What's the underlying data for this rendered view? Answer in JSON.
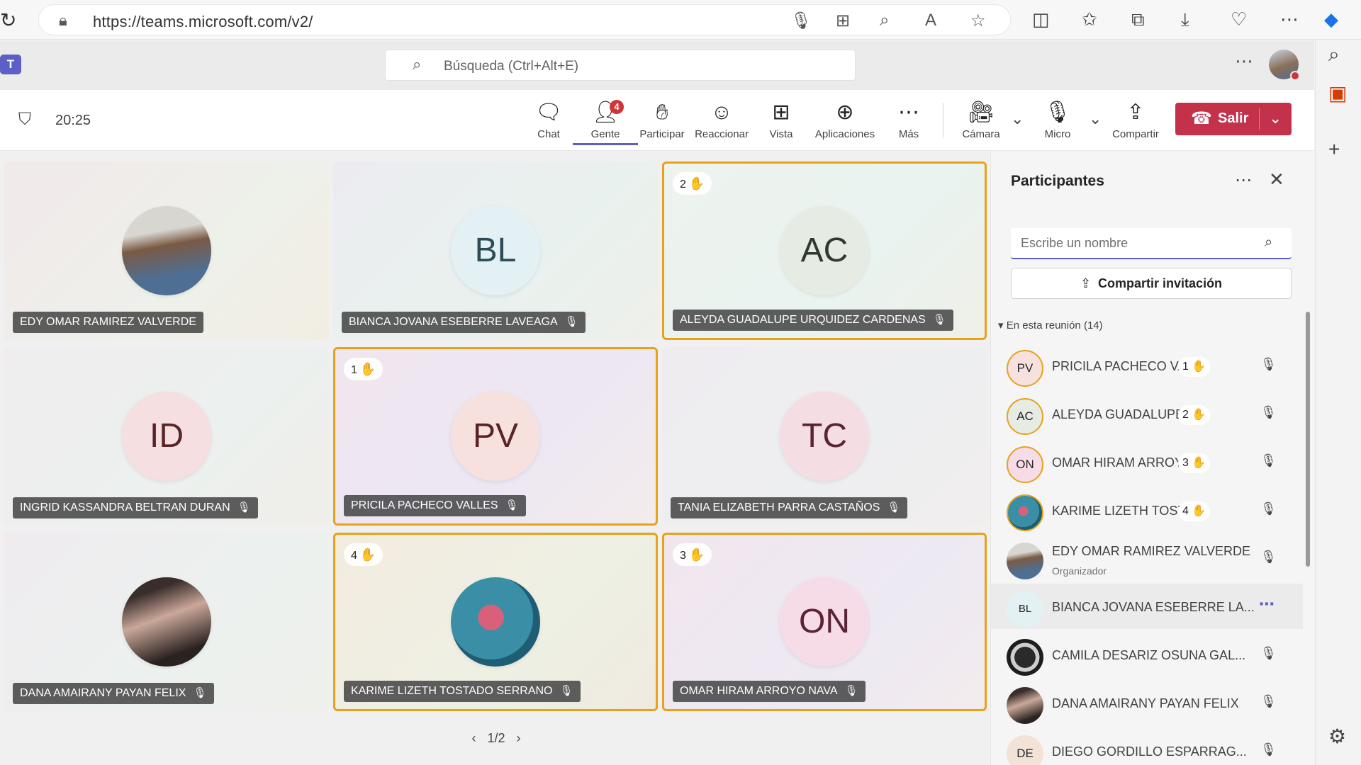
{
  "browser": {
    "url": "https://teams.microsoft.com/v2/"
  },
  "header": {
    "logo_text": "T",
    "search_placeholder": "Búsqueda (Ctrl+Alt+E)"
  },
  "meeting": {
    "timer": "20:25",
    "toolbar": [
      {
        "label": "Chat",
        "icon": "chat-icon"
      },
      {
        "label": "Gente",
        "icon": "people-icon",
        "badge": "4",
        "active": true
      },
      {
        "label": "Participar",
        "icon": "raise-hand-icon"
      },
      {
        "label": "Reaccionar",
        "icon": "react-icon"
      },
      {
        "label": "Vista",
        "icon": "view-icon"
      },
      {
        "label": "Aplicaciones",
        "icon": "apps-icon"
      },
      {
        "label": "Más",
        "icon": "more-icon"
      },
      {
        "label": "Cámara",
        "icon": "camera-off-icon"
      },
      {
        "label": "Micro",
        "icon": "mic-icon"
      },
      {
        "label": "Compartir",
        "icon": "share-icon"
      }
    ],
    "leave_label": "Salir"
  },
  "tiles": [
    {
      "name": "EDY OMAR RAMIREZ VALVERDE",
      "initials": "",
      "photo": true,
      "muted": false,
      "hand": ""
    },
    {
      "name": "BIANCA JOVANA ESEBERRE LAVEAGA",
      "initials": "BL",
      "muted": true,
      "hand": ""
    },
    {
      "name": "ALEYDA GUADALUPE URQUIDEZ CARDENAS",
      "initials": "AC",
      "muted": true,
      "hand": "2"
    },
    {
      "name": "INGRID KASSANDRA BELTRAN DURAN",
      "initials": "ID",
      "muted": true,
      "hand": ""
    },
    {
      "name": "PRICILA PACHECO VALLES",
      "initials": "PV",
      "muted": true,
      "hand": "1"
    },
    {
      "name": "TANIA ELIZABETH PARRA CASTAÑOS",
      "initials": "TC",
      "muted": true,
      "hand": ""
    },
    {
      "name": "DANA AMAIRANY PAYAN FELIX",
      "initials": "",
      "photo": true,
      "muted": true,
      "hand": ""
    },
    {
      "name": "KARIME LIZETH TOSTADO SERRANO",
      "initials": "",
      "photo": true,
      "muted": true,
      "hand": "4"
    },
    {
      "name": "OMAR HIRAM ARROYO NAVA",
      "initials": "ON",
      "muted": true,
      "hand": "3"
    }
  ],
  "pager": "1/2",
  "panel": {
    "title": "Participantes",
    "search_placeholder": "Escribe un nombre",
    "invite_label": "Compartir invitación",
    "section_label": "En esta reunión (14)",
    "participants": [
      {
        "name": "PRICILA PACHECO VAL...",
        "initials": "PV",
        "hand": "1",
        "mic": "muted"
      },
      {
        "name": "ALEYDA GUADALUPE ...",
        "initials": "AC",
        "hand": "2",
        "mic": "muted"
      },
      {
        "name": "OMAR HIRAM ARROY...",
        "initials": "ON",
        "hand": "3",
        "mic": "muted"
      },
      {
        "name": "KARIME LIZETH TOSTA...",
        "initials": "",
        "hand": "4",
        "mic": "muted"
      },
      {
        "name": "EDY OMAR RAMIREZ VALVERDE",
        "initials": "",
        "role": "Organizador",
        "hand": "",
        "mic": "on"
      },
      {
        "name": "BIANCA JOVANA ESEBERRE LA...",
        "initials": "BL",
        "hand": "",
        "mic": "more"
      },
      {
        "name": "CAMILA DESARIZ OSUNA GAL...",
        "initials": "",
        "hand": "",
        "mic": "muted"
      },
      {
        "name": "DANA AMAIRANY PAYAN FELIX",
        "initials": "",
        "hand": "",
        "mic": "muted"
      },
      {
        "name": "DIEGO GORDILLO ESPARRAG...",
        "initials": "DE",
        "hand": "",
        "mic": "muted"
      }
    ]
  },
  "colors": {
    "accent": "#5b5fc7",
    "leave": "#c4314b",
    "hand_highlight": "#e6a21b"
  }
}
